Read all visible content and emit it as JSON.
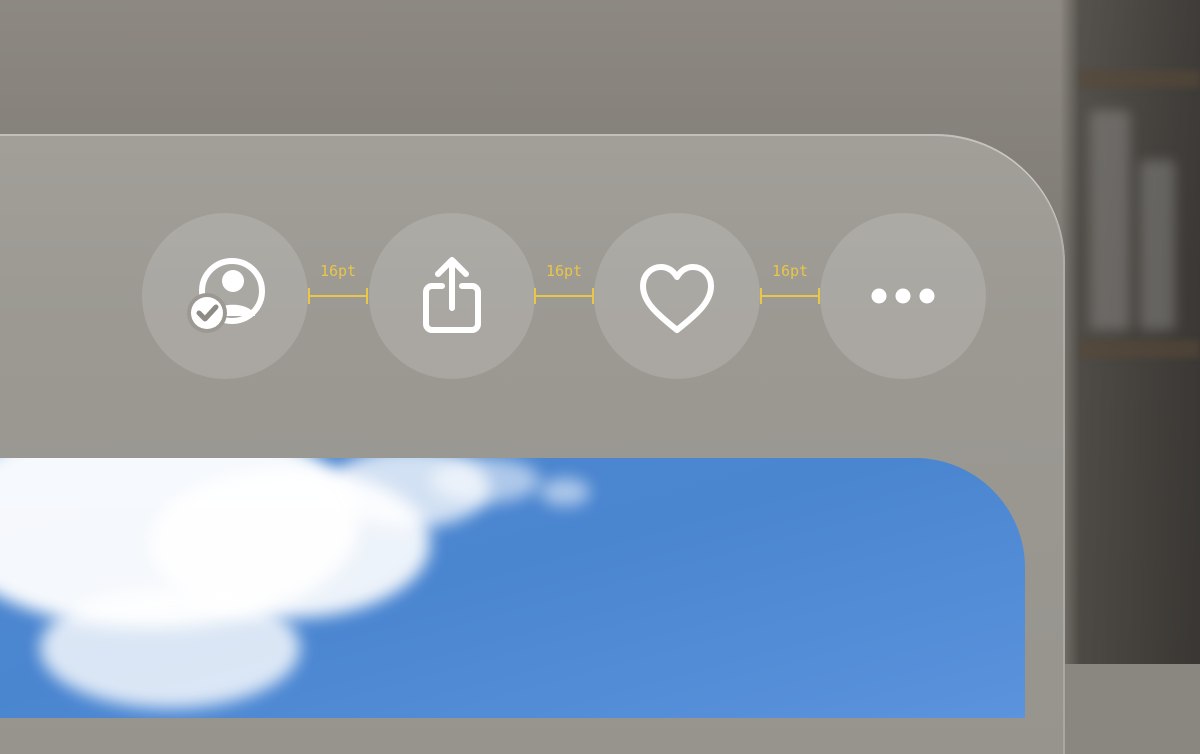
{
  "toolbar": {
    "buttons": [
      {
        "id": "share-with-people",
        "icon": "person-checkmark-icon"
      },
      {
        "id": "share",
        "icon": "share-icon"
      },
      {
        "id": "favorite",
        "icon": "heart-icon"
      },
      {
        "id": "more",
        "icon": "ellipsis-icon"
      }
    ],
    "spacing_labels": [
      "16pt",
      "16pt",
      "16pt"
    ]
  },
  "colors": {
    "annotation": "#e7c64a",
    "button_fill": "rgba(255,255,255,0.14)",
    "icon": "#ffffff",
    "sky": "#4f88cf"
  }
}
